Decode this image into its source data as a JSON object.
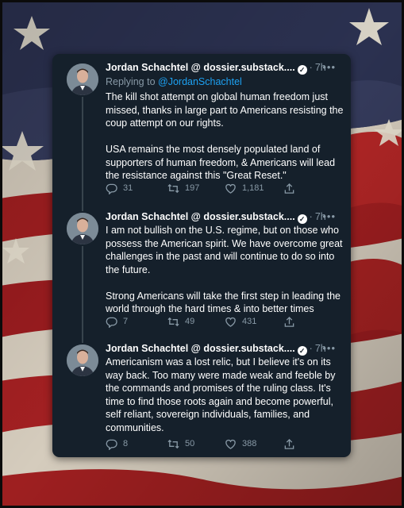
{
  "tweets": [
    {
      "author": "Jordan Schachtel @ dossier.substack....",
      "time": "7h",
      "reply_prefix": "Replying to ",
      "reply_handle": "@JordanSchachtel",
      "text": "The kill shot attempt on global human freedom just missed, thanks in large part to Americans resisting the coup attempt on our rights.\n\nUSA remains the most densely populated land of supporters of human freedom, & Americans will lead the resistance against this \"Great Reset.\"",
      "replies": "31",
      "retweets": "197",
      "likes": "1,181"
    },
    {
      "author": "Jordan Schachtel @ dossier.substack....",
      "time": "7h",
      "text": "I am not bullish on the U.S. regime, but on those who possess the American spirit. We have overcome great challenges in the past and will continue to do so into the future.\n\nStrong Americans will take the first step in leading the world through the hard times & into better times",
      "replies": "7",
      "retweets": "49",
      "likes": "431"
    },
    {
      "author": "Jordan Schachtel @ dossier.substack....",
      "time": "7h",
      "text": "Americanism was a lost relic, but I believe it's on its way back. Too many were made weak and feeble by the commands and promises of the ruling class. It's time to find those roots again and become powerful, self reliant, sovereign individuals, families, and communities.",
      "replies": "8",
      "retweets": "50",
      "likes": "388"
    }
  ],
  "icons": {
    "verified": "verified-badge-icon",
    "more": "more-options-icon",
    "reply": "reply-icon",
    "retweet": "retweet-icon",
    "like": "heart-icon",
    "share": "share-icon"
  },
  "colors": {
    "card_bg": "#15202b",
    "text": "#ffffff",
    "secondary": "#8899a6",
    "link": "#1da1f2",
    "thread_line": "#38444d",
    "flag_blue": "#2e3350",
    "flag_red": "#a3201f",
    "flag_white": "#d8cfc0"
  }
}
